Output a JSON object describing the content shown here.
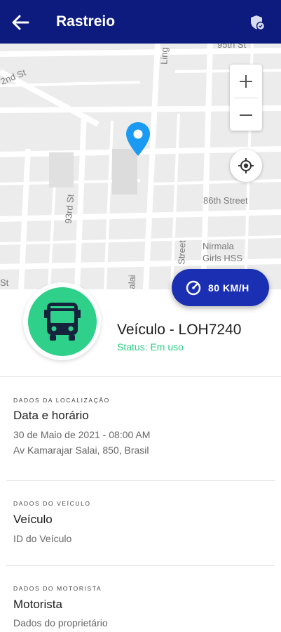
{
  "header": {
    "title": "Rastreio",
    "back_icon": "arrow-left-icon",
    "action_icon": "shield-icon"
  },
  "map": {
    "streets": [
      "95th St",
      "2nd St",
      "93rd St",
      "86th Street",
      "Street",
      "Nirmala",
      "Girls HSS",
      "St",
      "alai",
      "Ling"
    ],
    "zoom_in": "+",
    "zoom_out": "−"
  },
  "speed": {
    "value": "80 KM/H",
    "icon": "speedometer-icon"
  },
  "vehicle": {
    "name": "Veículo - LOH7240",
    "status": "Status: Em uso",
    "icon": "bus-icon"
  },
  "sections": {
    "location": {
      "caption": "DADOS DA LOCALIZAÇÃO",
      "title": "Data e horário",
      "datetime": "30 de Maio de 2021 - 08:00 AM",
      "address": "Av Kamarajar Salai, 850, Brasil"
    },
    "vehicle": {
      "caption": "DADOS DO VEÍCULO",
      "title": "Veículo",
      "detail": "ID do Veículo"
    },
    "driver": {
      "caption": "DADOS DO MOTORISTA",
      "title": "Motorista",
      "detail": "Dados do proprietário"
    }
  },
  "colors": {
    "header": "#0d1b7e",
    "speed_pill": "#1b2fb3",
    "status_green": "#2ecf86",
    "pin_blue": "#1a9af2"
  }
}
